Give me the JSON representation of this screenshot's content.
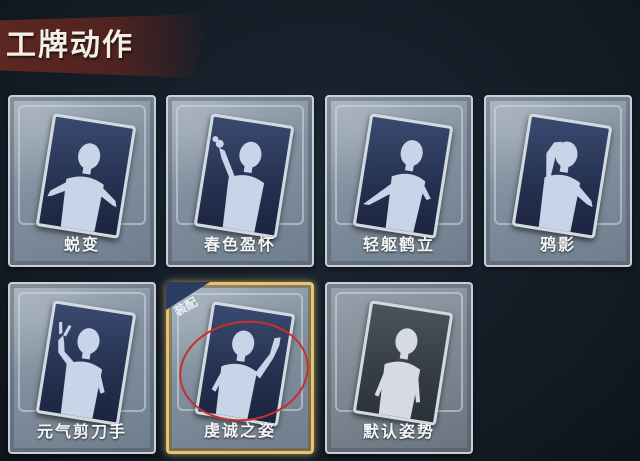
{
  "header": {
    "title": "工牌动作"
  },
  "cards": [
    {
      "label": "蜕变",
      "pose": "arms-out"
    },
    {
      "label": "春色盈怀",
      "pose": "flower"
    },
    {
      "label": "轻躯鹤立",
      "pose": "side-reach"
    },
    {
      "label": "鸦影",
      "pose": "hand-head"
    },
    {
      "label": "元气剪刀手",
      "pose": "peace"
    },
    {
      "label": "虔诚之姿",
      "pose": "raise-hand",
      "selected": true,
      "badge": "装配"
    },
    {
      "label": "默认姿势",
      "pose": "default"
    }
  ],
  "colors": {
    "selected_border": "#e8c56a",
    "badge_bg": "#2b3d63",
    "annotation_circle": "#c7302a"
  }
}
